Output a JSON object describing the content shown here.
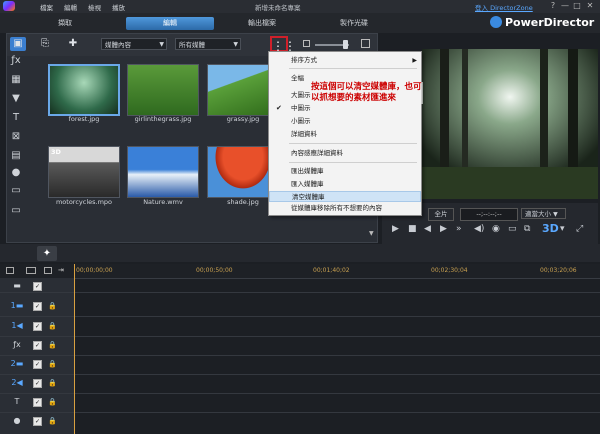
{
  "app": {
    "menus": [
      "檔案",
      "編輯",
      "檢視",
      "播放"
    ],
    "title": "新增未命名專案",
    "login": "登入 DirectorZone",
    "brand": "PowerDirector",
    "window_buttons": [
      "?",
      "—",
      "□",
      "✕"
    ]
  },
  "modes": [
    {
      "label": "擷取"
    },
    {
      "label": "編輯",
      "active": true
    },
    {
      "label": "輸出檔案"
    },
    {
      "label": "製作光碟"
    }
  ],
  "library": {
    "filter_content": "媒體內容",
    "filter_all": "所有媒體",
    "items": [
      {
        "label": "forest.jpg"
      },
      {
        "label": "girlinthegrass.jpg"
      },
      {
        "label": "grassy.jpg"
      },
      {
        "label": "motorcycles.mpo",
        "badge": "3D"
      },
      {
        "label": "Nature.wmv"
      },
      {
        "label": "shade.jpg"
      }
    ]
  },
  "context_menu": {
    "items": [
      {
        "label": "排序方式",
        "submenu": true
      },
      {
        "label": "全幅"
      },
      {
        "label": "大圖示"
      },
      {
        "label": "中圖示",
        "checked": true
      },
      {
        "label": "小圖示"
      },
      {
        "label": "詳細資料"
      },
      {
        "label": "內容感應詳細資料"
      },
      {
        "label": "匯出媒體庫"
      },
      {
        "label": "匯入媒體庫"
      },
      {
        "label": "清空媒體庫",
        "hover": true
      },
      {
        "label": "從媒體庫移除所有不想要的內容"
      }
    ]
  },
  "annotation": "按這個可以清空媒體庫，也可以抓想要的素材匯進來",
  "preview": {
    "full_label": "全片",
    "timecode": "--;--:--;--",
    "size_label": "適當大小",
    "mode_3d": "3D"
  },
  "timeline": {
    "ticks": [
      "00;00;00;00",
      "00;00;50;00",
      "00;01;40;02",
      "00;02;30;04",
      "00;03;20;06"
    ]
  },
  "colors": {
    "accent": "#3b7fd0",
    "highlight_box": "#d0202a",
    "annotation_text": "#cc0000",
    "menu_hover": "#cfe3f6"
  }
}
